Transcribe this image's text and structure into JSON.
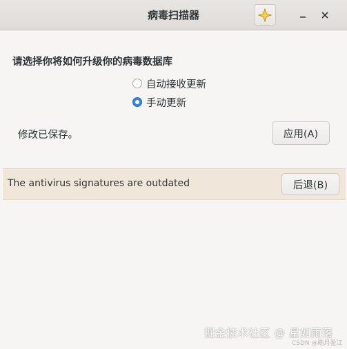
{
  "window": {
    "title": "病毒扫描器",
    "star_icon": "sparkle-star-icon",
    "minimize_icon": "minimize-icon",
    "close_icon": "close-icon"
  },
  "update_settings": {
    "heading": "请选择你将如何升级你的病毒数据库",
    "options": [
      {
        "label": "自动接收更新",
        "checked": false
      },
      {
        "label": "手动更新",
        "checked": true
      }
    ],
    "saved_message": "修改已保存。",
    "apply_label": "应用(A)"
  },
  "infobar": {
    "message": "The antivirus signatures are outdated",
    "back_label": "后退(B)"
  },
  "colors": {
    "accent": "#3584e4",
    "infobar_bg": "#f1e6da",
    "window_bg": "#f6f5f4"
  },
  "watermark": {
    "text": "掘金技术社区 @ 星如雨落",
    "credit": "CSDN @皓月盈江"
  }
}
